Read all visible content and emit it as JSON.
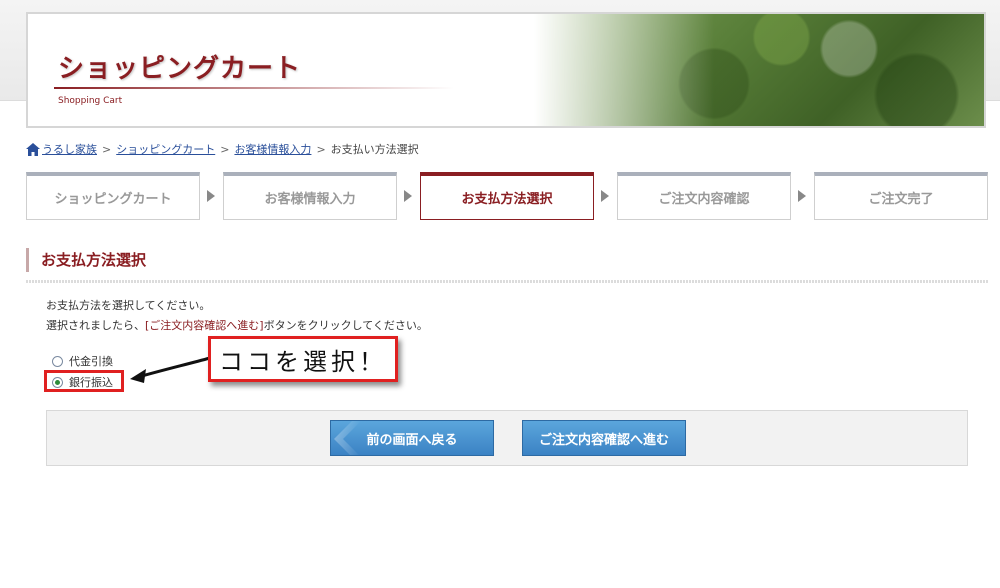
{
  "header": {
    "title": "ショッピングカート",
    "subtitle": "Shopping Cart"
  },
  "breadcrumb": {
    "home": "うるし家族",
    "items": [
      "ショッピングカート",
      "お客様情報入力"
    ],
    "current": "お支払い方法選択",
    "separator": ">"
  },
  "steps": [
    {
      "label": "ショッピングカート",
      "active": false
    },
    {
      "label": "お客様情報入力",
      "active": false
    },
    {
      "label": "お支払方法選択",
      "active": true
    },
    {
      "label": "ご注文内容確認",
      "active": false
    },
    {
      "label": "ご注文完了",
      "active": false
    }
  ],
  "section": {
    "heading": "お支払方法選択",
    "instruction1": "お支払方法を選択してください。",
    "instruction2_pre": "選択されましたら、",
    "instruction2_highlight": "[ご注文内容確認へ進む]",
    "instruction2_post": "ボタンをクリックしてください。"
  },
  "payment_options": [
    {
      "label": "代金引換",
      "checked": false
    },
    {
      "label": "銀行振込",
      "checked": true
    }
  ],
  "annotation": {
    "callout_text": "ココを選択！",
    "color": "#e02020"
  },
  "buttons": {
    "back_label": "前の画面へ戻る",
    "next_label": "ご注文内容確認へ進む"
  },
  "colors": {
    "accent": "#8a1e22",
    "link": "#2a4f9a",
    "button": "#3b82c4"
  }
}
